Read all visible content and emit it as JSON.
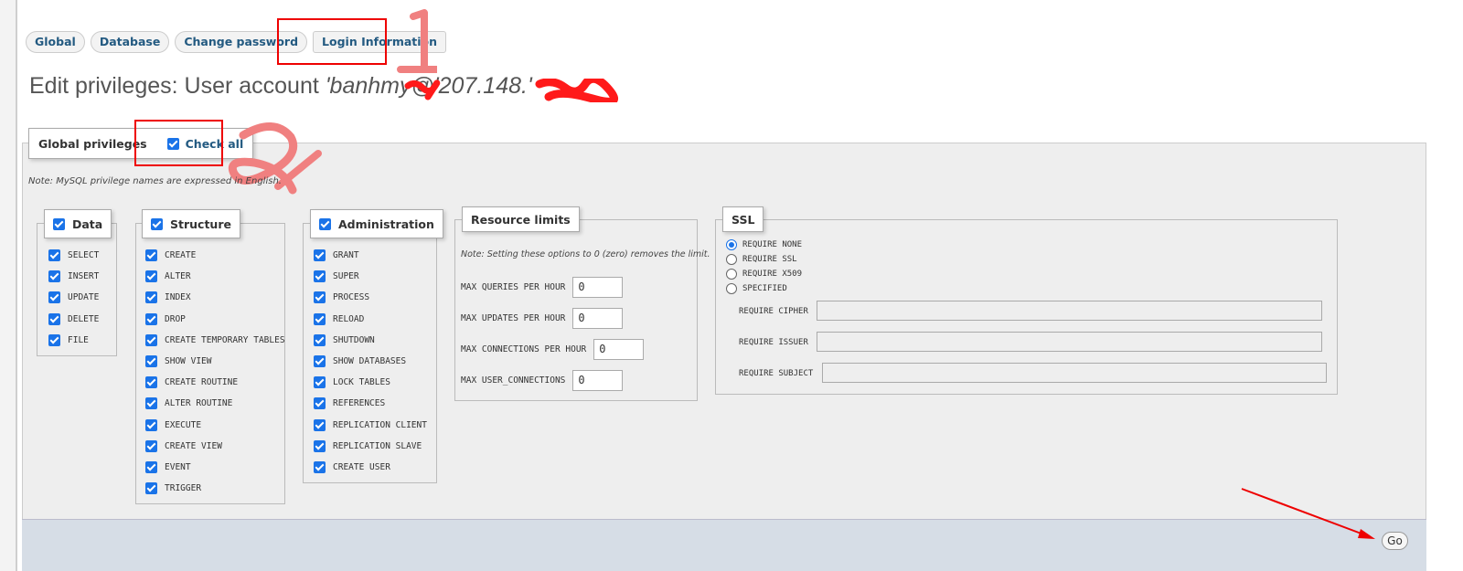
{
  "tabs": [
    "Global",
    "Database",
    "Change password",
    "Login Information"
  ],
  "title": {
    "prefix": "Edit privileges: User account ",
    "account": "'banhmy@'207.148.'"
  },
  "global_privileges": {
    "label": "Global privileges",
    "check_all_label": "Check all",
    "check_all_checked": true
  },
  "note": "Note: MySQL privilege names are expressed in English.",
  "data_group": {
    "label": "Data",
    "items": [
      "SELECT",
      "INSERT",
      "UPDATE",
      "DELETE",
      "FILE"
    ]
  },
  "structure_group": {
    "label": "Structure",
    "items": [
      "CREATE",
      "ALTER",
      "INDEX",
      "DROP",
      "CREATE TEMPORARY TABLES",
      "SHOW VIEW",
      "CREATE ROUTINE",
      "ALTER ROUTINE",
      "EXECUTE",
      "CREATE VIEW",
      "EVENT",
      "TRIGGER"
    ]
  },
  "admin_group": {
    "label": "Administration",
    "items": [
      "GRANT",
      "SUPER",
      "PROCESS",
      "RELOAD",
      "SHUTDOWN",
      "SHOW DATABASES",
      "LOCK TABLES",
      "REFERENCES",
      "REPLICATION CLIENT",
      "REPLICATION SLAVE",
      "CREATE USER"
    ]
  },
  "resource_limits": {
    "label": "Resource limits",
    "note": "Note: Setting these options to 0 (zero) removes the limit.",
    "fields": [
      {
        "label": "MAX QUERIES PER HOUR",
        "value": "0"
      },
      {
        "label": "MAX UPDATES PER HOUR",
        "value": "0"
      },
      {
        "label": "MAX CONNECTIONS PER HOUR",
        "value": "0"
      },
      {
        "label": "MAX USER_CONNECTIONS",
        "value": "0"
      }
    ]
  },
  "ssl": {
    "label": "SSL",
    "options": [
      "REQUIRE NONE",
      "REQUIRE SSL",
      "REQUIRE X509",
      "SPECIFIED"
    ],
    "selected": "REQUIRE NONE",
    "fields": [
      "REQUIRE CIPHER",
      "REQUIRE ISSUER",
      "REQUIRE SUBJECT"
    ]
  },
  "go_label": "Go",
  "colors": {
    "link": "#235a81",
    "checkbox": "#1a73e8",
    "annotation": "#e00000",
    "footer": "#d6dde6"
  }
}
